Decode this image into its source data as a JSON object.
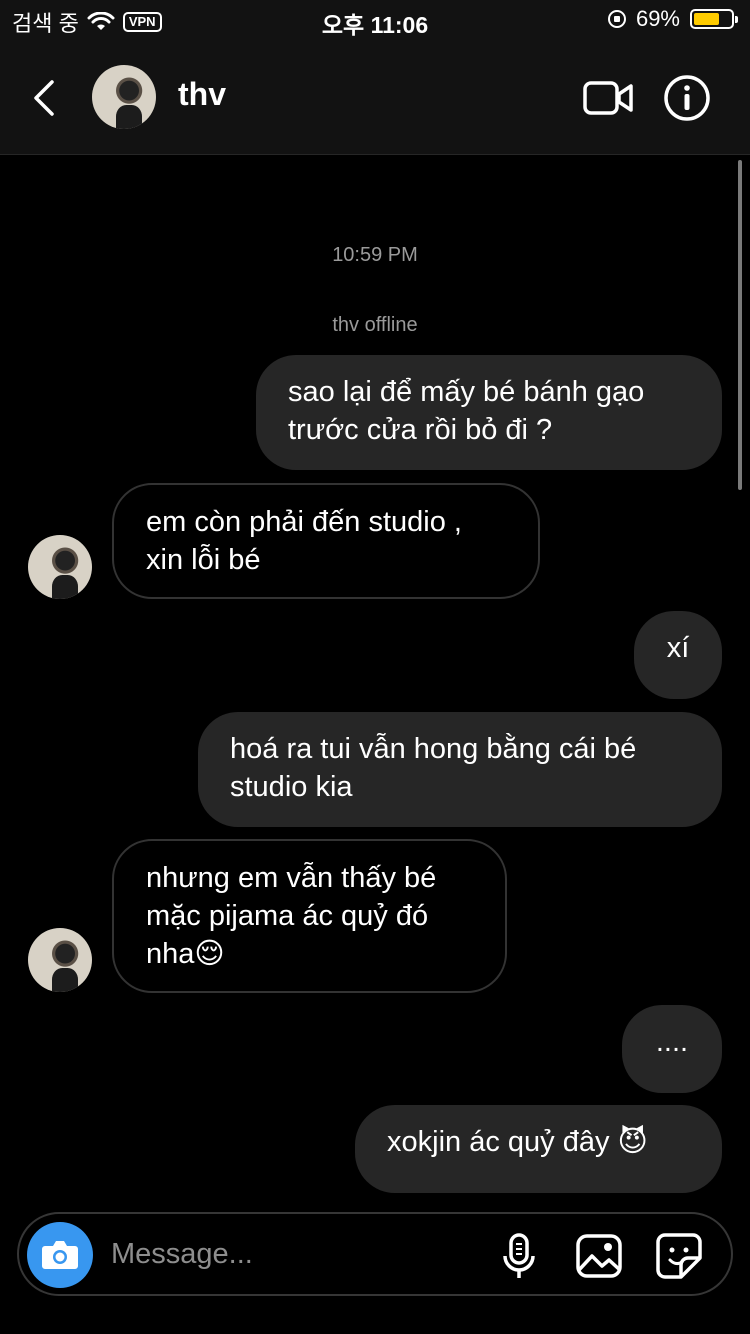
{
  "status_bar": {
    "carrier": "검색 중",
    "vpn": "VPN",
    "time": "오후 11:06",
    "battery_percent": "69%",
    "battery_level": 0.69
  },
  "header": {
    "username": "thv",
    "icons": [
      "back-chevron-icon",
      "video-call-icon",
      "info-icon"
    ]
  },
  "chat": {
    "timestamp": "10:59 PM",
    "presence": "thv offline",
    "messages": [
      {
        "direction": "out",
        "lines": [
          "sao lại để mấy bé bánh gạo",
          "trước cửa rồi bỏ đi ?"
        ]
      },
      {
        "direction": "in",
        "lines": [
          "em còn phải đến studio ,",
          "xin lỗi bé"
        ]
      },
      {
        "direction": "out",
        "lines": [
          "xí"
        ]
      },
      {
        "direction": "out",
        "lines": [
          "hoá ra tui vẫn hong bằng cái bé",
          "studio kia"
        ]
      },
      {
        "direction": "in",
        "lines": [
          "nhưng em vẫn thấy bé",
          "mặc pijama ác quỷ đó",
          "nha😌"
        ]
      },
      {
        "direction": "out",
        "lines": [
          "...."
        ]
      },
      {
        "direction": "out",
        "lines": [
          "xokjin ác quỷ đây 😈"
        ]
      }
    ]
  },
  "composer": {
    "placeholder": "Message...",
    "icons": [
      "camera-icon",
      "microphone-icon",
      "gallery-icon",
      "sticker-icon"
    ]
  },
  "colors": {
    "background": "#000000",
    "bar": "#121212",
    "outgoing_bubble": "#262626",
    "camera_button": "#3897f0",
    "meta_text": "#9a9a9a"
  }
}
